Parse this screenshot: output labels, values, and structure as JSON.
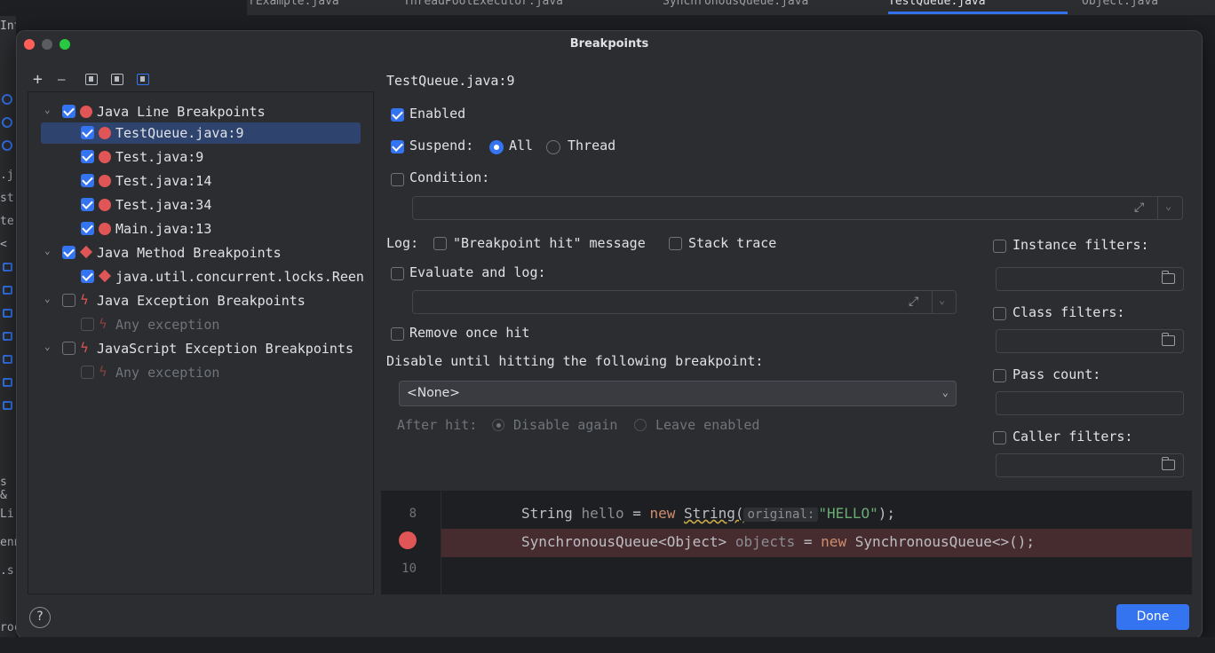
{
  "background": {
    "tabs": [
      "rExample.java",
      "ThreadPoolExecutor.java",
      "SynchronousQueue.java",
      "TestQueue.java",
      "Object.java"
    ],
    "left_fragments": [
      "Interna",
      ".j",
      "st",
      "te",
      "<",
      "s &",
      "Li",
      "enn",
      ".s",
      "roc"
    ]
  },
  "dialog": {
    "title": "Breakpoints",
    "help_label": "?",
    "done_label": "Done"
  },
  "toolbar": {
    "add_label": "+",
    "remove_label": "—"
  },
  "tree": [
    {
      "label": "Java Line Breakpoints",
      "checked": true,
      "kind": "dot"
    },
    {
      "label": "TestQueue.java:9",
      "checked": true,
      "kind": "dot"
    },
    {
      "label": "Test.java:9",
      "checked": true,
      "kind": "dot"
    },
    {
      "label": "Test.java:14",
      "checked": true,
      "kind": "dot"
    },
    {
      "label": "Test.java:34",
      "checked": true,
      "kind": "dot"
    },
    {
      "label": "Main.java:13",
      "checked": true,
      "kind": "dot"
    },
    {
      "label": "Java Method Breakpoints",
      "checked": true,
      "kind": "diamond"
    },
    {
      "label": "java.util.concurrent.locks.Reen",
      "checked": true,
      "kind": "diamond"
    },
    {
      "label": "Java Exception Breakpoints",
      "checked": false,
      "kind": "bolt"
    },
    {
      "label": "Any exception",
      "checked": false,
      "kind": "bolt"
    },
    {
      "label": "JavaScript Exception Breakpoints",
      "checked": false,
      "kind": "bolt"
    },
    {
      "label": "Any exception",
      "checked": false,
      "kind": "bolt"
    }
  ],
  "details": {
    "heading": "TestQueue.java:9",
    "enabled_label": "Enabled",
    "suspend_label": "Suspend:",
    "suspend_all": "All",
    "suspend_thread": "Thread",
    "condition_label": "Condition:",
    "log_label": "Log:",
    "log_message_label": "\"Breakpoint hit\" message",
    "stack_trace_label": "Stack trace",
    "evaluate_label": "Evaluate and log:",
    "remove_once_label": "Remove once hit",
    "disable_until_label": "Disable until hitting the following breakpoint:",
    "disable_until_value": "<None>",
    "after_hit_label": "After hit:",
    "disable_again_label": "Disable again",
    "leave_enabled_label": "Leave enabled",
    "instance_filters_label": "Instance filters:",
    "class_filters_label": "Class filters:",
    "pass_count_label": "Pass count:",
    "caller_filters_label": "Caller filters:"
  },
  "code": {
    "line_8": "8",
    "line_10": "10",
    "line8_type": "String ",
    "line8_var": "hello",
    "line8_eq": " = ",
    "line8_new": "new ",
    "line8_ctor": "String(",
    "line8_hint": "original:",
    "line8_str": "\"HELLO\"",
    "line8_end": ");",
    "line9_type": "SynchronousQueue<Object> ",
    "line9_var": "objects",
    "line9_eq": " = ",
    "line9_new": "new ",
    "line9_ctor": "SynchronousQueue<>();"
  },
  "colors": {
    "accent": "#3574f0",
    "breakpoint": "#e05555",
    "selection": "#2e436e",
    "breakpoint_line": "#472c2f"
  }
}
